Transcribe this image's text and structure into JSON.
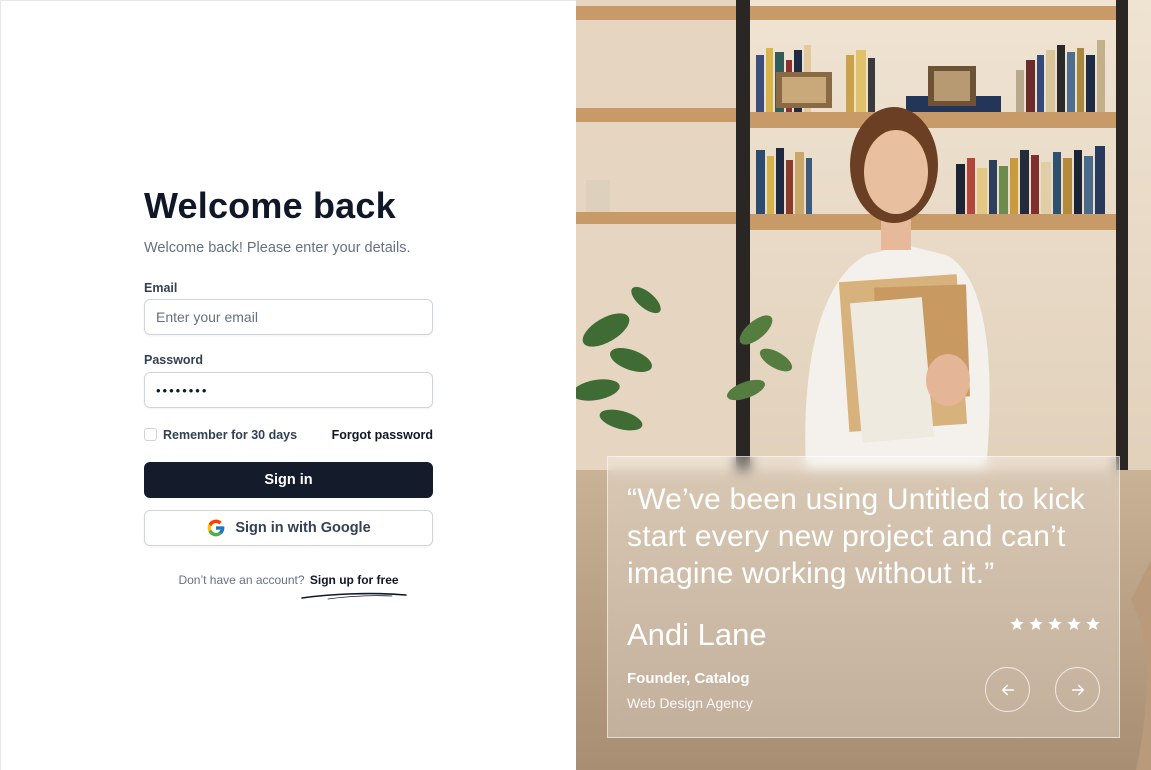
{
  "login": {
    "title": "Welcome back",
    "subtitle": "Welcome back! Please enter your details.",
    "email_label": "Email",
    "email_placeholder": "Enter your email",
    "email_value": "",
    "password_label": "Password",
    "password_value": "••••••••",
    "remember_label": "Remember for 30 days",
    "remember_checked": false,
    "forgot_label": "Forgot password",
    "signin_label": "Sign in",
    "google_label": "Sign in with Google",
    "no_account_text": "Don’t have an account?",
    "signup_label": "Sign up for free"
  },
  "testimonial": {
    "quote": "“We’ve been using Untitled to kick start every new project and can’t imagine working without it.”",
    "author": "Andi Lane",
    "role": "Founder, Catalog",
    "company": "Web Design Agency",
    "rating": 5
  },
  "icons": {
    "google": "google-icon",
    "star": "star-icon",
    "prev": "arrow-left-icon",
    "next": "arrow-right-icon"
  },
  "colors": {
    "primary_button": "#141c2c",
    "text_primary": "#101828",
    "text_secondary": "#667085",
    "border": "#d0d5dd"
  }
}
